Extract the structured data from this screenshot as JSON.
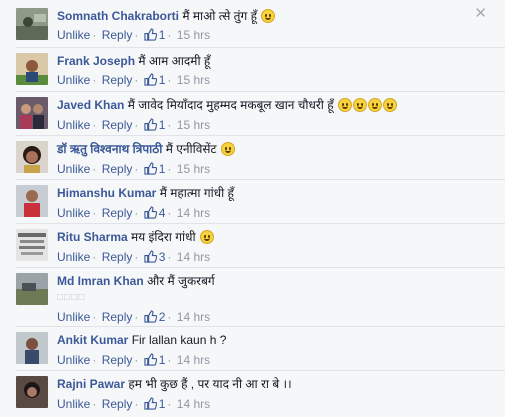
{
  "close_symbol": "✕",
  "icons": {
    "like": "thumbs-up-icon",
    "close": "close-icon"
  },
  "colors": {
    "name_link": "#3b5998",
    "meta_text": "#9197a3",
    "background": "#f6f7f9"
  },
  "comments": [
    {
      "name": "Somnath Chakraborti",
      "text": "मैं माओ त्से तुंग हूँ",
      "emojis": 1,
      "unlike": "Unlike",
      "reply": "Reply",
      "likes": "1",
      "time": "15 hrs"
    },
    {
      "name": "Frank Joseph",
      "text": "मैं आम आदमी हूँ",
      "emojis": 0,
      "unlike": "Unlike",
      "reply": "Reply",
      "likes": "1",
      "time": "15 hrs"
    },
    {
      "name": "Javed Khan",
      "text": "मैं जावेद मियाँदाद मुहम्मद मकबूल खान चौधरी हूँ",
      "emojis": 4,
      "unlike": "Unlike",
      "reply": "Reply",
      "likes": "1",
      "time": "15 hrs"
    },
    {
      "name": "डॉ ऋतु विश्वनाथ त्रिपाठी",
      "text": "मैं एनीविसेंट",
      "emojis": 1,
      "unlike": "Unlike",
      "reply": "Reply",
      "likes": "1",
      "time": "15 hrs"
    },
    {
      "name": "Himanshu Kumar",
      "text": "मैं महात्मा गांधी हूँ",
      "emojis": 0,
      "unlike": "Unlike",
      "reply": "Reply",
      "likes": "4",
      "time": "14 hrs"
    },
    {
      "name": "Ritu Sharma",
      "text": "मय इंदिरा गांधी",
      "emojis": 1,
      "unlike": "Unlike",
      "reply": "Reply",
      "likes": "3",
      "time": "14 hrs"
    },
    {
      "name": "Md Imran Khan",
      "text": "और मैं जुकरबर्ग",
      "boxes": "□□□□",
      "emojis": 0,
      "unlike": "Unlike",
      "reply": "Reply",
      "likes": "2",
      "time": "14 hrs"
    },
    {
      "name": "Ankit Kumar",
      "text": "Fir lallan kaun h ?",
      "emojis": 0,
      "unlike": "Unlike",
      "reply": "Reply",
      "likes": "1",
      "time": "14 hrs"
    },
    {
      "name": "Rajni Pawar",
      "text": "हम भी कुछ हैं , पर याद नी आ रा बे ।।",
      "emojis": 0,
      "unlike": "Unlike",
      "reply": "Reply",
      "likes": "1",
      "time": "14 hrs"
    }
  ]
}
